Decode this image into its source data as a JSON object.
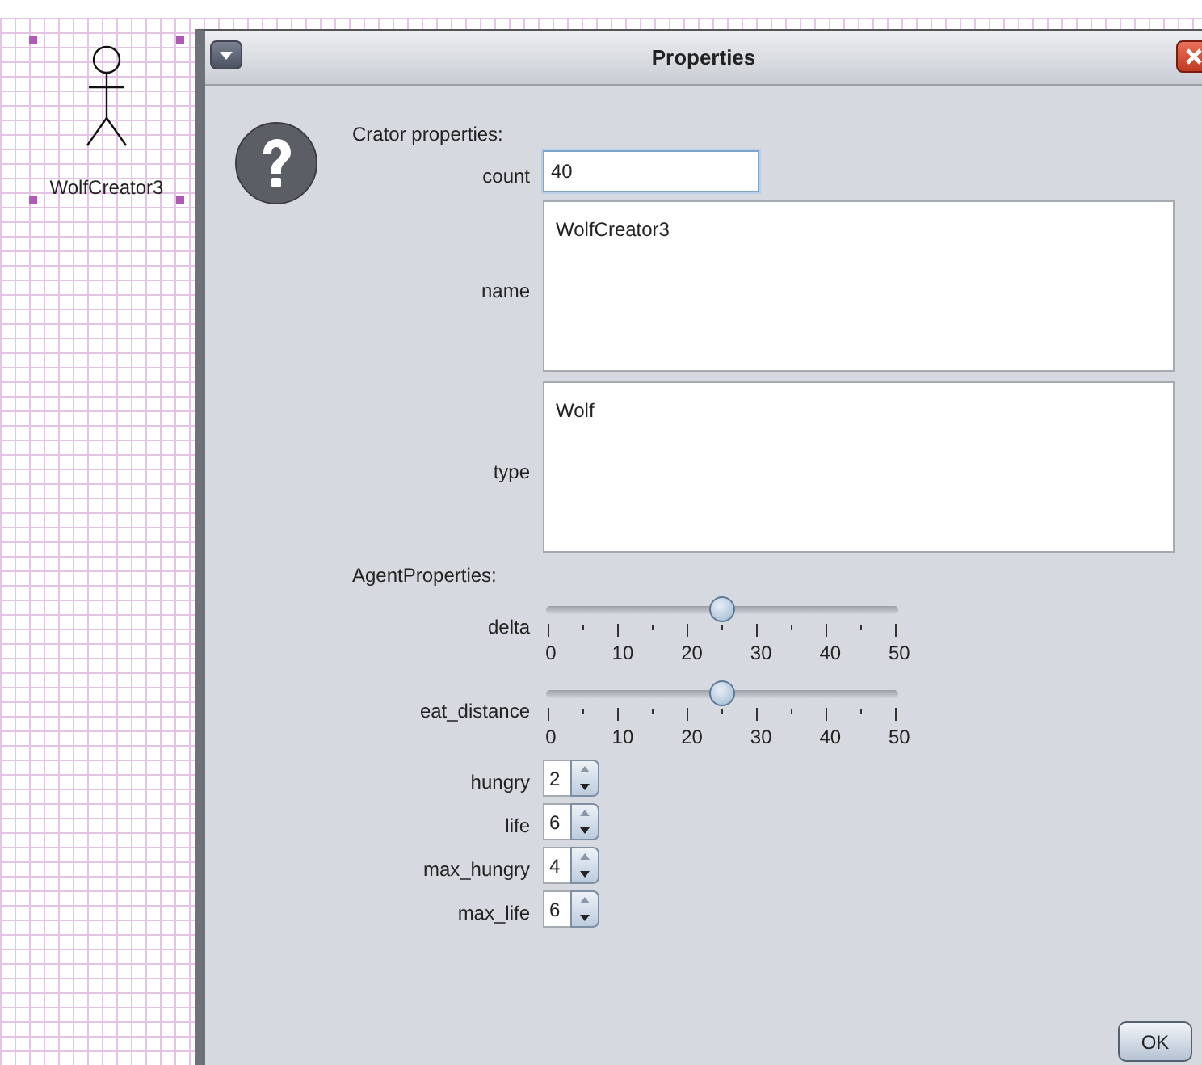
{
  "canvas": {
    "node": {
      "label": "WolfCreator3",
      "selected": true
    }
  },
  "dialog": {
    "title": "Properties",
    "sections": [
      {
        "heading": "Crator properties:",
        "fields": [
          {
            "kind": "text",
            "label": "count",
            "value": "40",
            "focused": true
          },
          {
            "kind": "area",
            "label": "name",
            "value": "WolfCreator3",
            "focused": false
          },
          {
            "kind": "area",
            "label": "type",
            "value": "Wolf",
            "focused": false
          }
        ]
      },
      {
        "heading": "AgentProperties:",
        "fields": [
          {
            "kind": "slider",
            "label": "delta",
            "level": 0.5,
            "tick_labels": [
              "0",
              "10",
              "20",
              "30",
              "40",
              "50"
            ]
          },
          {
            "kind": "slider",
            "label": "eat_distance",
            "level": 0.5,
            "tick_labels": [
              "0",
              "10",
              "20",
              "30",
              "40",
              "50"
            ]
          },
          {
            "kind": "spinner",
            "label": "hungry",
            "value": "2"
          },
          {
            "kind": "spinner",
            "label": "life",
            "value": "6"
          },
          {
            "kind": "spinner",
            "label": "max_hungry",
            "value": "4"
          },
          {
            "kind": "spinner",
            "label": "max_life",
            "value": "6"
          }
        ]
      }
    ],
    "buttons": [
      "OK"
    ]
  }
}
